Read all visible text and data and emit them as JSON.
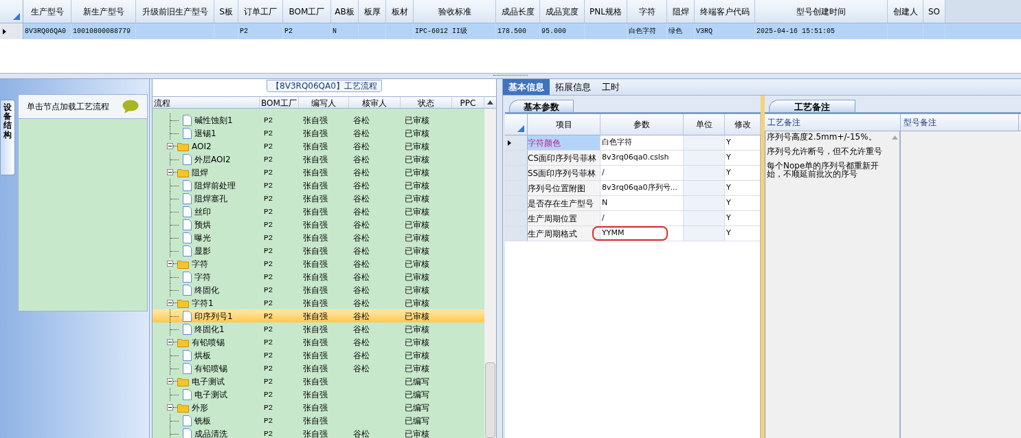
{
  "top_grid": {
    "columns": [
      "生产型号",
      "新生产型号",
      "升级前旧生产型号",
      "S板",
      "订单工厂",
      "BOM工厂",
      "AB板",
      "板厚",
      "板材",
      "验收标准",
      "成品长度",
      "成品宽度",
      "PNL规格",
      "字符",
      "阻焊",
      "终端客户代码",
      "型号创建时间",
      "创建人",
      "SO"
    ],
    "rows": [
      {
        "selected": true,
        "cells": [
          "8V3RQ06QA0",
          "10010800088779",
          null,
          null,
          "P2",
          "P2",
          "N",
          null,
          null,
          "IPC-6012 II级",
          "178.500",
          "95.000",
          null,
          "白色字符",
          "绿色",
          "V3RQ",
          "2025-04-16 15:51:05",
          null,
          null
        ]
      }
    ]
  },
  "side_panel": {
    "side_tab": "设备结构",
    "hint": "单击节点加载工艺流程"
  },
  "flow": {
    "title": "【8V3RQ06QA0】工艺流程",
    "columns": [
      "流程",
      "BOM工厂",
      "编写人",
      "核审人",
      "状态",
      "PPC"
    ],
    "orphan_children": [
      {
        "name": "碱性蚀刻1",
        "bom": "P2",
        "writer": "张自强",
        "reviewer": "谷松",
        "status": "已审核",
        "selected": false
      },
      {
        "name": "退锡1",
        "bom": "P2",
        "writer": "张自强",
        "reviewer": "谷松",
        "status": "已审核",
        "selected": false
      }
    ],
    "groups": [
      {
        "name": "AOI2",
        "bom": "P2",
        "writer": "张自强",
        "reviewer": "谷松",
        "status": "已审核",
        "expanded": true,
        "children": [
          {
            "name": "外层AOI2",
            "bom": "P2",
            "writer": "张自强",
            "reviewer": "谷松",
            "status": "已审核",
            "selected": false
          }
        ]
      },
      {
        "name": "阻焊",
        "bom": "P2",
        "writer": "张自强",
        "reviewer": "谷松",
        "status": "已审核",
        "expanded": true,
        "children": [
          {
            "name": "阻焊前处理",
            "bom": "P2",
            "writer": "张自强",
            "reviewer": "谷松",
            "status": "已审核",
            "selected": false
          },
          {
            "name": "阻焊塞孔",
            "bom": "P2",
            "writer": "张自强",
            "reviewer": "谷松",
            "status": "已审核",
            "selected": false
          },
          {
            "name": "丝印",
            "bom": "P2",
            "writer": "张自强",
            "reviewer": "谷松",
            "status": "已审核",
            "selected": false
          },
          {
            "name": "预烘",
            "bom": "P2",
            "writer": "张自强",
            "reviewer": "谷松",
            "status": "已审核",
            "selected": false
          },
          {
            "name": "曝光",
            "bom": "P2",
            "writer": "张自强",
            "reviewer": "谷松",
            "status": "已审核",
            "selected": false
          },
          {
            "name": "显影",
            "bom": "P2",
            "writer": "张自强",
            "reviewer": "谷松",
            "status": "已审核",
            "selected": false
          }
        ]
      },
      {
        "name": "字符",
        "bom": "P2",
        "writer": "张自强",
        "reviewer": "谷松",
        "status": "已审核",
        "expanded": true,
        "children": [
          {
            "name": "字符",
            "bom": "P2",
            "writer": "张自强",
            "reviewer": "谷松",
            "status": "已审核",
            "selected": false
          },
          {
            "name": "终固化",
            "bom": "P2",
            "writer": "张自强",
            "reviewer": "谷松",
            "status": "已审核",
            "selected": false
          }
        ]
      },
      {
        "name": "字符1",
        "bom": "P2",
        "writer": "张自强",
        "reviewer": "谷松",
        "status": "已审核",
        "expanded": true,
        "children": [
          {
            "name": "印序列号1",
            "bom": "P2",
            "writer": "张自强",
            "reviewer": "谷松",
            "status": "已审核",
            "selected": true
          },
          {
            "name": "终固化1",
            "bom": "P2",
            "writer": "张自强",
            "reviewer": "谷松",
            "status": "已审核",
            "selected": false
          }
        ]
      },
      {
        "name": "有铅喷锡",
        "bom": "P2",
        "writer": "张自强",
        "reviewer": "谷松",
        "status": "已审核",
        "expanded": true,
        "children": [
          {
            "name": "烘板",
            "bom": "P2",
            "writer": "张自强",
            "reviewer": "谷松",
            "status": "已审核",
            "selected": false
          },
          {
            "name": "有铅喷锡",
            "bom": "P2",
            "writer": "张自强",
            "reviewer": "谷松",
            "status": "已审核",
            "selected": false
          }
        ]
      },
      {
        "name": "电子测试",
        "bom": "P2",
        "writer": "张自强",
        "status": "已编写",
        "expanded": true,
        "children": [
          {
            "name": "电子测试",
            "bom": "P2",
            "writer": "张自强",
            "status": "已编写",
            "selected": false
          }
        ]
      },
      {
        "name": "外形",
        "bom": "P2",
        "writer": "张自强",
        "status": "已编写",
        "expanded": true,
        "children": [
          {
            "name": "铣板",
            "bom": "P2",
            "writer": "张自强",
            "status": "已编写",
            "selected": false
          },
          {
            "name": "成品清洗",
            "bom": "P2",
            "writer": "张自强",
            "reviewer": "谷松",
            "status": "已审核",
            "selected": false
          }
        ]
      }
    ]
  },
  "detail": {
    "tabs": [
      {
        "label": "基本信息",
        "selected": true
      },
      {
        "label": "拓展信息",
        "selected": false
      },
      {
        "label": "工时",
        "selected": false
      }
    ],
    "subtab": "基本参数",
    "columns": [
      "项目",
      "参数",
      "单位",
      "修改"
    ],
    "rows": [
      {
        "item": "字符颜色",
        "param": "白色字符",
        "modify": "Y",
        "current": true,
        "circled": false
      },
      {
        "item": "CS面印序列号菲林",
        "param": "8v3rq06qa0.cslsh",
        "modify": "Y",
        "current": false,
        "circled": false
      },
      {
        "item": "SS面印序列号菲林",
        "param": "/",
        "modify": "Y",
        "current": false,
        "circled": false
      },
      {
        "item": "序列号位置附图",
        "param": "8v3rq06qa0序列号...",
        "modify": "Y",
        "current": false,
        "circled": false
      },
      {
        "item": "是否存在生产型号",
        "param": "N",
        "modify": "Y",
        "current": false,
        "circled": false
      },
      {
        "item": "生产周期位置",
        "param": "/",
        "modify": "Y",
        "current": false,
        "circled": false
      },
      {
        "item": "生产周期格式",
        "param": "YYMM",
        "modify": "Y",
        "current": false,
        "circled": true
      }
    ]
  },
  "notes": {
    "tab": "工艺备注",
    "columns": [
      "工艺备注",
      "型号备注"
    ],
    "process_note": [
      "序列号高度2.5mm+/-15%。",
      "序列号允许断号，但不允许重号",
      "每个Nope单的序列号都重新开始，不顺延前批次的序号"
    ]
  }
}
